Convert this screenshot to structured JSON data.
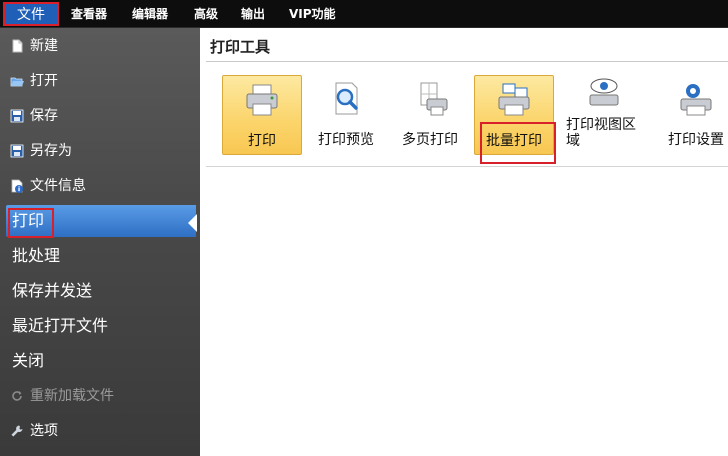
{
  "menubar": {
    "items": [
      "文件",
      "查看器",
      "编辑器",
      "高级",
      "输出",
      "VIP功能"
    ]
  },
  "sidebar": {
    "items": [
      {
        "label": "新建",
        "icon": "new-file-icon"
      },
      {
        "label": "打开",
        "icon": "open-folder-icon"
      },
      {
        "label": "保存",
        "icon": "save-icon"
      },
      {
        "label": "另存为",
        "icon": "save-as-icon"
      },
      {
        "label": "文件信息",
        "icon": "info-icon"
      },
      {
        "label": "打印",
        "selected": true
      },
      {
        "label": "批处理"
      },
      {
        "label": "保存并发送"
      },
      {
        "label": "最近打开文件"
      },
      {
        "label": "关闭"
      },
      {
        "label": "重新加载文件",
        "icon": "reload-icon",
        "disabled": true
      },
      {
        "label": "选项",
        "icon": "wrench-icon"
      }
    ]
  },
  "main": {
    "title": "打印工具",
    "tools": [
      {
        "label": "打印",
        "icon": "printer-icon",
        "active": true
      },
      {
        "label": "打印预览",
        "icon": "print-preview-icon"
      },
      {
        "label": "多页打印",
        "icon": "multi-page-print-icon"
      },
      {
        "label": "批量打印",
        "icon": "batch-print-icon",
        "active": true
      },
      {
        "label": "打印视图区域",
        "icon": "print-view-area-icon"
      },
      {
        "label": "打印设置",
        "icon": "print-settings-icon"
      }
    ]
  },
  "colors": {
    "menubar_bg": "#0d0d0d",
    "file_tab_bg": "#1f5fb8",
    "highlight_red": "#d8202a",
    "sidebar_selected": "#3b7fd4",
    "tool_active": "#fbd46a"
  }
}
